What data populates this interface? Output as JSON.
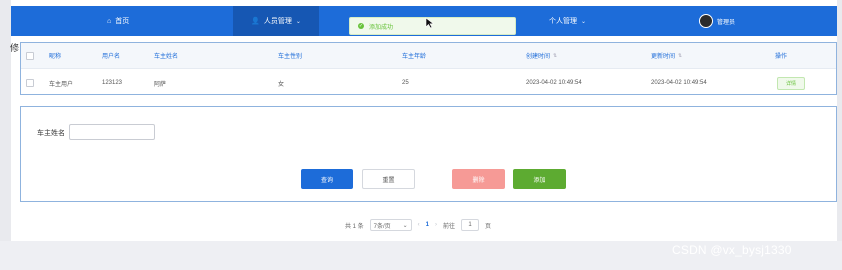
{
  "nav": {
    "home_label": "首页",
    "people_label": "人员管理",
    "personal_label": "个人管理",
    "user_label": "管理员"
  },
  "toast": {
    "text": "添加成功"
  },
  "side_char": "修",
  "table": {
    "columns": [
      "昵称",
      "用户名",
      "车主姓名",
      "车主性别",
      "车主年龄",
      "创建时间",
      "更新时间",
      "操作"
    ],
    "rows": [
      {
        "nickname": "车主用户",
        "username": "123123",
        "owner_name": "阿萨",
        "gender": "女",
        "age": "25",
        "created": "2023-04-02 10:49:54",
        "updated": "2023-04-02 10:49:54",
        "action": "详情"
      }
    ]
  },
  "search": {
    "label": "车主姓名",
    "value": "",
    "query_label": "查询",
    "reset_label": "重置",
    "delete_label": "删除",
    "add_label": "添加"
  },
  "pagination": {
    "total_text": "共 1 条",
    "page_size": "7条/页",
    "current_page": "1",
    "goto_label": "前往",
    "goto_value": "1",
    "page_suffix": "页"
  },
  "watermark": "CSDN @vx_bysj1330",
  "colors": {
    "primary": "#1d6cd9",
    "success": "#5dab31",
    "danger_light": "#f69a96"
  }
}
